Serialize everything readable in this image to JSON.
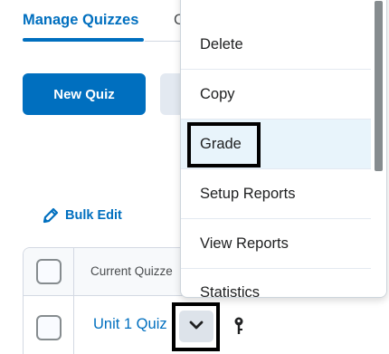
{
  "tabs": {
    "active_label": "Manage Quizzes",
    "next_label_partial": "C"
  },
  "toolbar": {
    "new_quiz_label": "New Quiz"
  },
  "bulk_edit": {
    "label": "Bulk Edit",
    "icon": "pencil-icon"
  },
  "table": {
    "header_label": "Current Quizze",
    "rows": [
      {
        "title": "Unit 1 Quiz"
      }
    ]
  },
  "context_menu": {
    "items": [
      {
        "label": "Delete"
      },
      {
        "label": "Copy"
      },
      {
        "label": "Grade",
        "selected": true
      },
      {
        "label": "Setup Reports"
      },
      {
        "label": "View Reports"
      },
      {
        "label": "Statistics"
      }
    ]
  },
  "colors": {
    "brand": "#006fbf",
    "highlight_bg": "#e8f4fb",
    "focus_outline": "#000000"
  }
}
